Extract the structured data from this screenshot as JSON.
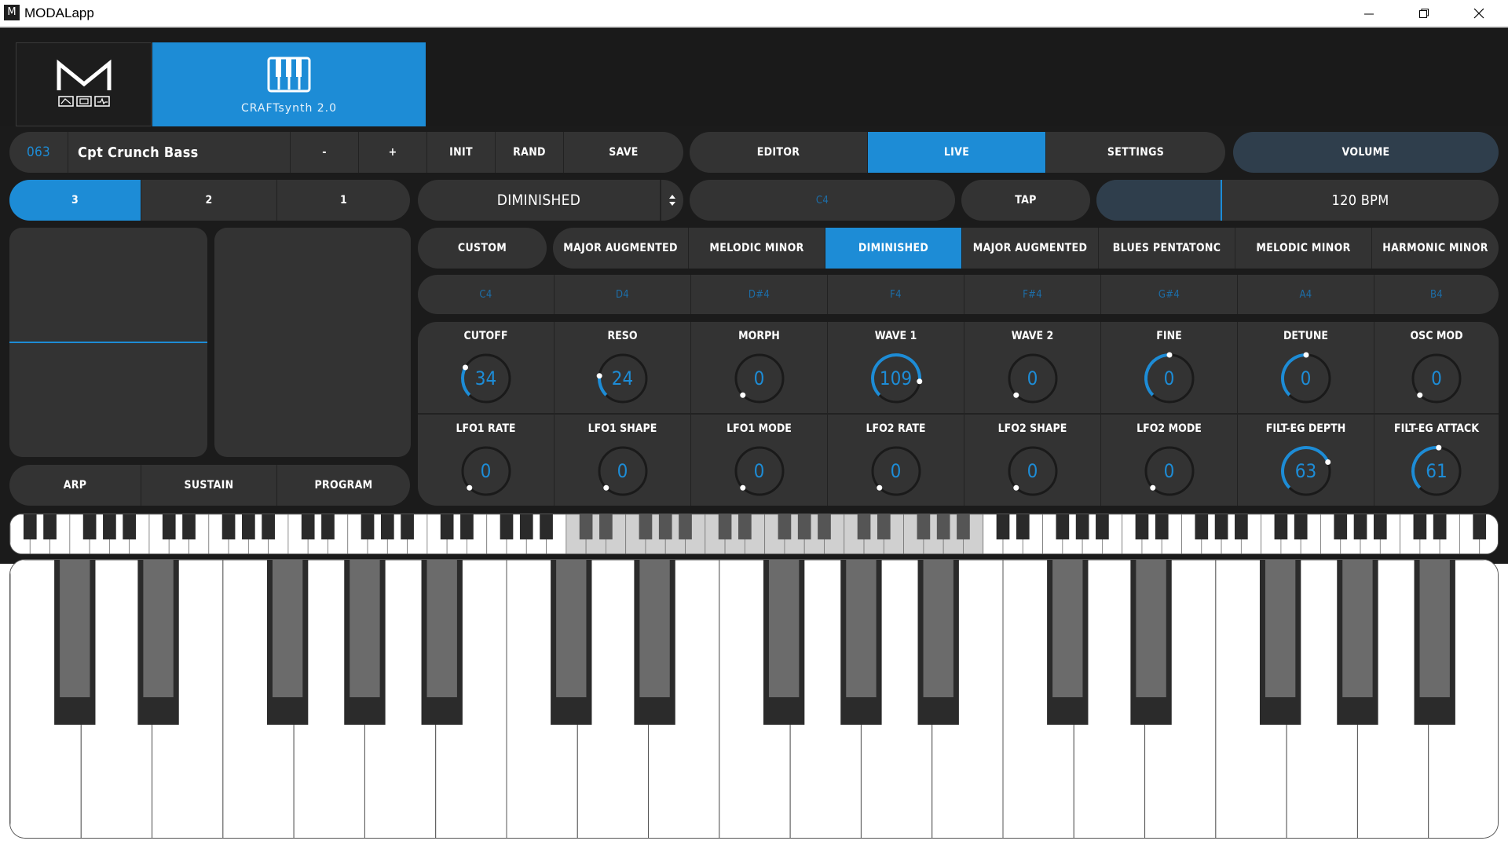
{
  "window": {
    "title": "MODALapp",
    "icon_letter": "M"
  },
  "header": {
    "logo_letter": "M",
    "product_label": "CRAFTsynth 2.0"
  },
  "preset": {
    "number": "063",
    "name": "Cpt Crunch Bass",
    "minus": "-",
    "plus": "+",
    "init": "INIT",
    "rand": "RAND",
    "save": "SAVE"
  },
  "modes": {
    "editor": "EDITOR",
    "live": "LIVE",
    "settings": "SETTINGS",
    "active": "LIVE"
  },
  "volume": {
    "label": "VOLUME"
  },
  "octave": {
    "items": [
      "3",
      "2",
      "1"
    ],
    "active": "3"
  },
  "scale_select": {
    "value": "DIMINISHED"
  },
  "root_note": {
    "value": "C4"
  },
  "tap": {
    "label": "TAP"
  },
  "tempo": {
    "value": "120 BPM"
  },
  "scales": {
    "items": [
      "CUSTOM",
      "MAJOR AUGMENTED",
      "MELODIC MINOR",
      "DIMINISHED",
      "MAJOR AUGMENTED",
      "BLUES PENTATONC",
      "MELODIC MINOR",
      "HARMONIC MINOR"
    ],
    "active_index": 3
  },
  "notes": {
    "items": [
      "C4",
      "D4",
      "D#4",
      "F4",
      "F#4",
      "G#4",
      "A4",
      "B4"
    ]
  },
  "knobs": {
    "row1": [
      {
        "label": "CUTOFF",
        "value": "34",
        "level": 0.27
      },
      {
        "label": "RESO",
        "value": "24",
        "level": 0.19
      },
      {
        "label": "MORPH",
        "value": "0",
        "level": 0
      },
      {
        "label": "WAVE 1",
        "value": "109",
        "level": 0.86
      },
      {
        "label": "WAVE 2",
        "value": "0",
        "level": 0
      },
      {
        "label": "FINE",
        "value": "0",
        "level": 0.5
      },
      {
        "label": "DETUNE",
        "value": "0",
        "level": 0.5
      },
      {
        "label": "OSC MOD",
        "value": "0",
        "level": 0
      }
    ],
    "row2": [
      {
        "label": "LFO1 RATE",
        "value": "0",
        "level": 0
      },
      {
        "label": "LFO1 SHAPE",
        "value": "0",
        "level": 0
      },
      {
        "label": "LFO1 MODE",
        "value": "0",
        "level": 0
      },
      {
        "label": "LFO2 RATE",
        "value": "0",
        "level": 0
      },
      {
        "label": "LFO2 SHAPE",
        "value": "0",
        "level": 0
      },
      {
        "label": "LFO2 MODE",
        "value": "0",
        "level": 0
      },
      {
        "label": "FILT-EG DEPTH",
        "value": "63",
        "level": 0.75
      },
      {
        "label": "FILT-EG ATTACK",
        "value": "61",
        "level": 0.52
      }
    ]
  },
  "bottom_buttons": {
    "arp": "ARP",
    "sustain": "SUSTAIN",
    "program": "PROGRAM"
  },
  "colors": {
    "accent": "#1d8cd6",
    "panel": "#333333",
    "background": "#1b1b1b"
  }
}
